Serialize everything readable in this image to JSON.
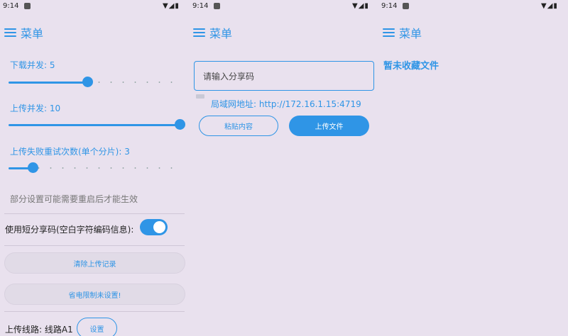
{
  "status_bar": {
    "time": "9:14",
    "icons": "▼◢▮"
  },
  "panels": {
    "settings": {
      "menu_label": "菜单",
      "download_concurrency": {
        "label": "下载并发: 5",
        "value": 5,
        "max": 15
      },
      "upload_concurrency": {
        "label": "上传并发: 10",
        "value": 10,
        "max": 10
      },
      "upload_retry": {
        "label": "上传失败重试次数(单个分片): 3",
        "value": 3,
        "max": 15
      },
      "restart_note": "部分设置可能需要重启后才能生效",
      "short_code": {
        "label": "使用短分享码(空白字符编码信息):",
        "enabled": true
      },
      "clear_upload_records": "清除上传记录",
      "power_saving": "省电限制未设置!",
      "upload_line": {
        "label": "上传线路: 线路A1",
        "button": "设置"
      }
    },
    "share": {
      "menu_label": "菜单",
      "input_placeholder": "请输入分享码",
      "lan_address": "局域网地址: http://172.16.1.15:4719",
      "paste_button": "粘贴内容",
      "upload_button": "上传文件"
    },
    "favorites": {
      "menu_label": "菜单",
      "empty_text": "暂未收藏文件"
    }
  },
  "colors": {
    "accent": "#2f95e6",
    "background": "#e9e1ee"
  }
}
